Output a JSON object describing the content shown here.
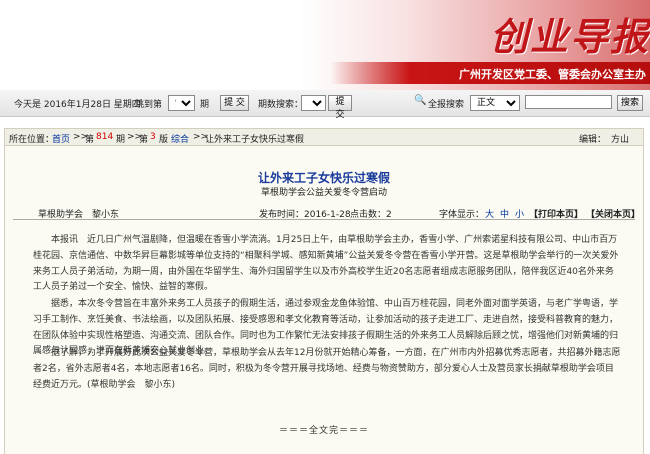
{
  "banner": {
    "logo_text": "创业导报",
    "subtitle": "广州开发区党工委、管委会办公室主办"
  },
  "toolbar": {
    "date_text": "今天是 2016年1月28日 星期四",
    "jump_label": "跳到第",
    "issue_value": "99",
    "issue_unit": "期",
    "submit_label": "提 交",
    "search_type_label": "期数搜索：",
    "search_type_value": "",
    "search_input_value": "",
    "search_submit_label": "提交",
    "fulltext_label": "全报搜索",
    "fulltext_field_value": "正文",
    "fulltext_input_value": "",
    "fulltext_button_label": "搜索"
  },
  "breadcrumb": {
    "prefix": "所在位置：",
    "home": "首页",
    "sep": ">>",
    "issue_prefix": "第",
    "issue_number": "814",
    "issue_suffix": "期",
    "page_prefix": "第",
    "page_number": "3",
    "page_suffix": "版",
    "section": "综合",
    "article": "让外来工子女快乐过寒假",
    "editor_label": "编辑：",
    "editor": "方山"
  },
  "article": {
    "title": "让外来工子女快乐过寒假",
    "subtitle": "草根助学会公益关爱冬令营启动",
    "author": "草根助学会　黎小东",
    "publish_time": "发布时间：2016-1-28",
    "views": "点击数：2",
    "font_label": "字体显示：",
    "font_large": "大",
    "font_medium": "中",
    "font_small": "小",
    "print_label": "【打印本页】",
    "close_label": "【关闭本页】",
    "paragraphs": [
      "本报讯　近几日广州气温剧降，但温暖在香雪小学流淌。1月25日上午，由草根助学会主办，香雪小学、广州索诺星科技有限公司、中山市百万桂花园、京信通信、中数华昇巨幕影城等单位支持的“相聚科学城、感知新黄埔”公益关爱冬令营在香雪小学开营。这是草根助学会举行的一次关爱外来务工人员子弟活动，为期一周，由外国在华留学生、海外归国留学生以及市外高校学生近20名志愿者组成志愿服务团队，陪伴我区近40名外来务工人员子弟过一个安全、愉快、益智的寒假。",
      "据悉，本次冬令营旨在丰富外来务工人员孩子的假期生活，通过参观金龙鱼体验馆、中山百万桂花园，同老外面对面学英语，与老广学粤语，学习手工制作、烹饪美食、书法绘画，以及团队拓展、接受感恩和孝文化教育等活动，让参加活动的孩子走进工厂、走进自然，接受科普教育的魅力，在团队体验中实现性格塑造、沟通交流、团队合作。同时也为工作繁忙无法安排孩子假期生活的外来务工人员解除后顾之忧，增强他们对新黄埔的归属感与认同感，进而在新黄埔安心就业创业。",
      "据了解，为了开展好此次公益关爱冬令营，草根助学会从去年12月份就开始精心筹备，一方面，在广州市内外招募优秀志愿者，共招募外籍志愿者2名，省外志愿者4名，本地志愿者16名。同时，积极为冬令营开展寻找场地、经费与物资赞助方，部分爱心人士及营员家长捐献草根助学会项目经费近万元。(草根助学会　黎小东)"
    ],
    "end_text": "＝＝＝全文完＝＝＝"
  },
  "colors": {
    "brand_red": "#c0161a",
    "title_blue": "#1a3b9c",
    "link_blue": "#003399"
  }
}
